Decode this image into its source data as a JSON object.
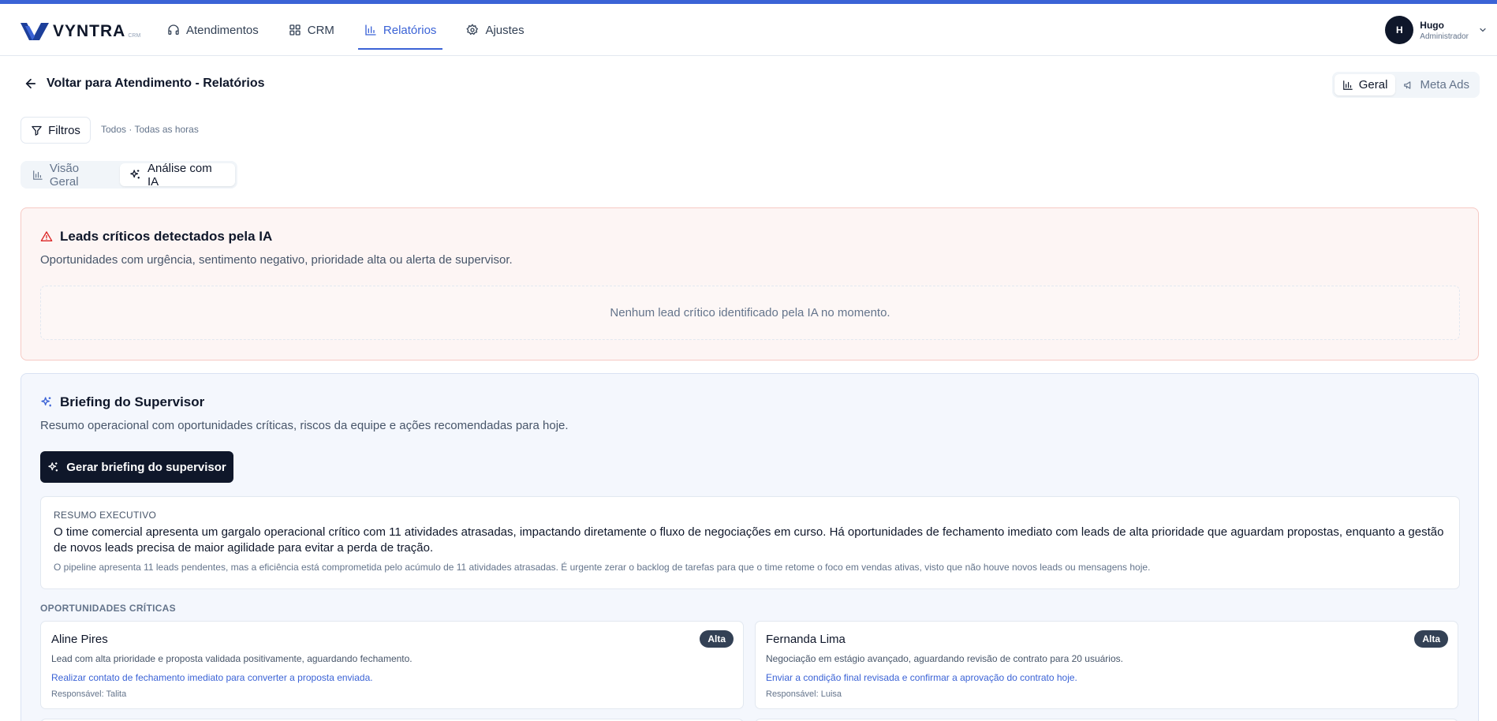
{
  "app": {
    "logo_text": "VYNTRA",
    "logo_suffix": "CRM",
    "brand_color": "#3b63d6"
  },
  "nav": {
    "items": [
      {
        "label": "Atendimentos",
        "icon": "headset-icon",
        "active": false
      },
      {
        "label": "CRM",
        "icon": "grid-icon",
        "active": false
      },
      {
        "label": "Relatórios",
        "icon": "bar-chart-icon",
        "active": true
      },
      {
        "label": "Ajustes",
        "icon": "gear-icon",
        "active": false
      }
    ]
  },
  "user": {
    "initial": "H",
    "name": "Hugo",
    "role": "Administrador"
  },
  "page": {
    "back_label": "Voltar para Atendimento - Relatórios",
    "view_switch": [
      {
        "label": "Geral",
        "icon": "bar-chart-icon",
        "active": true
      },
      {
        "label": "Meta Ads",
        "icon": "megaphone-icon",
        "active": false
      }
    ]
  },
  "filters": {
    "button_label": "Filtros",
    "summary": "Todos · Todas as horas"
  },
  "tabs": [
    {
      "label": "Visão Geral",
      "icon": "bar-chart-icon",
      "active": false
    },
    {
      "label": "Análise com IA",
      "icon": "sparkles-icon",
      "active": true
    }
  ],
  "critical_leads": {
    "title": "Leads críticos detectados pela IA",
    "subtitle": "Oportunidades com urgência, sentimento negativo, prioridade alta ou alerta de supervisor.",
    "empty_message": "Nenhum lead crítico identificado pela IA no momento."
  },
  "briefing": {
    "title": "Briefing do Supervisor",
    "subtitle": "Resumo operacional com oportunidades críticas, riscos da equipe e ações recomendadas para hoje.",
    "generate_button": "Gerar briefing do supervisor",
    "exec_label": "RESUMO EXECUTIVO",
    "exec_text": "O time comercial apresenta um gargalo operacional crítico com 11 atividades atrasadas, impactando diretamente o fluxo de negociações em curso. Há oportunidades de fechamento imediato com leads de alta prioridade que aguardam propostas, enquanto a gestão de novos leads precisa de maior agilidade para evitar a perda de tração.",
    "exec_note": "O pipeline apresenta 11 leads pendentes, mas a eficiência está comprometida pelo acúmulo de 11 atividades atrasadas. É urgente zerar o backlog de tarefas para que o time retome o foco em vendas ativas, visto que não houve novos leads ou mensagens hoje.",
    "opportunities_label": "OPORTUNIDADES CRÍTICAS",
    "opportunities": [
      {
        "name": "Aline Pires",
        "priority": "Alta",
        "description": "Lead com alta prioridade e proposta validada positivamente, aguardando fechamento.",
        "action": "Realizar contato de fechamento imediato para converter a proposta enviada.",
        "owner": "Responsável: Talita"
      },
      {
        "name": "Fernanda Lima",
        "priority": "Alta",
        "description": "Negociação em estágio avançado, aguardando revisão de contrato para 20 usuários.",
        "action": "Enviar a condição final revisada e confirmar a aprovação do contrato hoje.",
        "owner": "Responsável: Luisa"
      }
    ]
  }
}
